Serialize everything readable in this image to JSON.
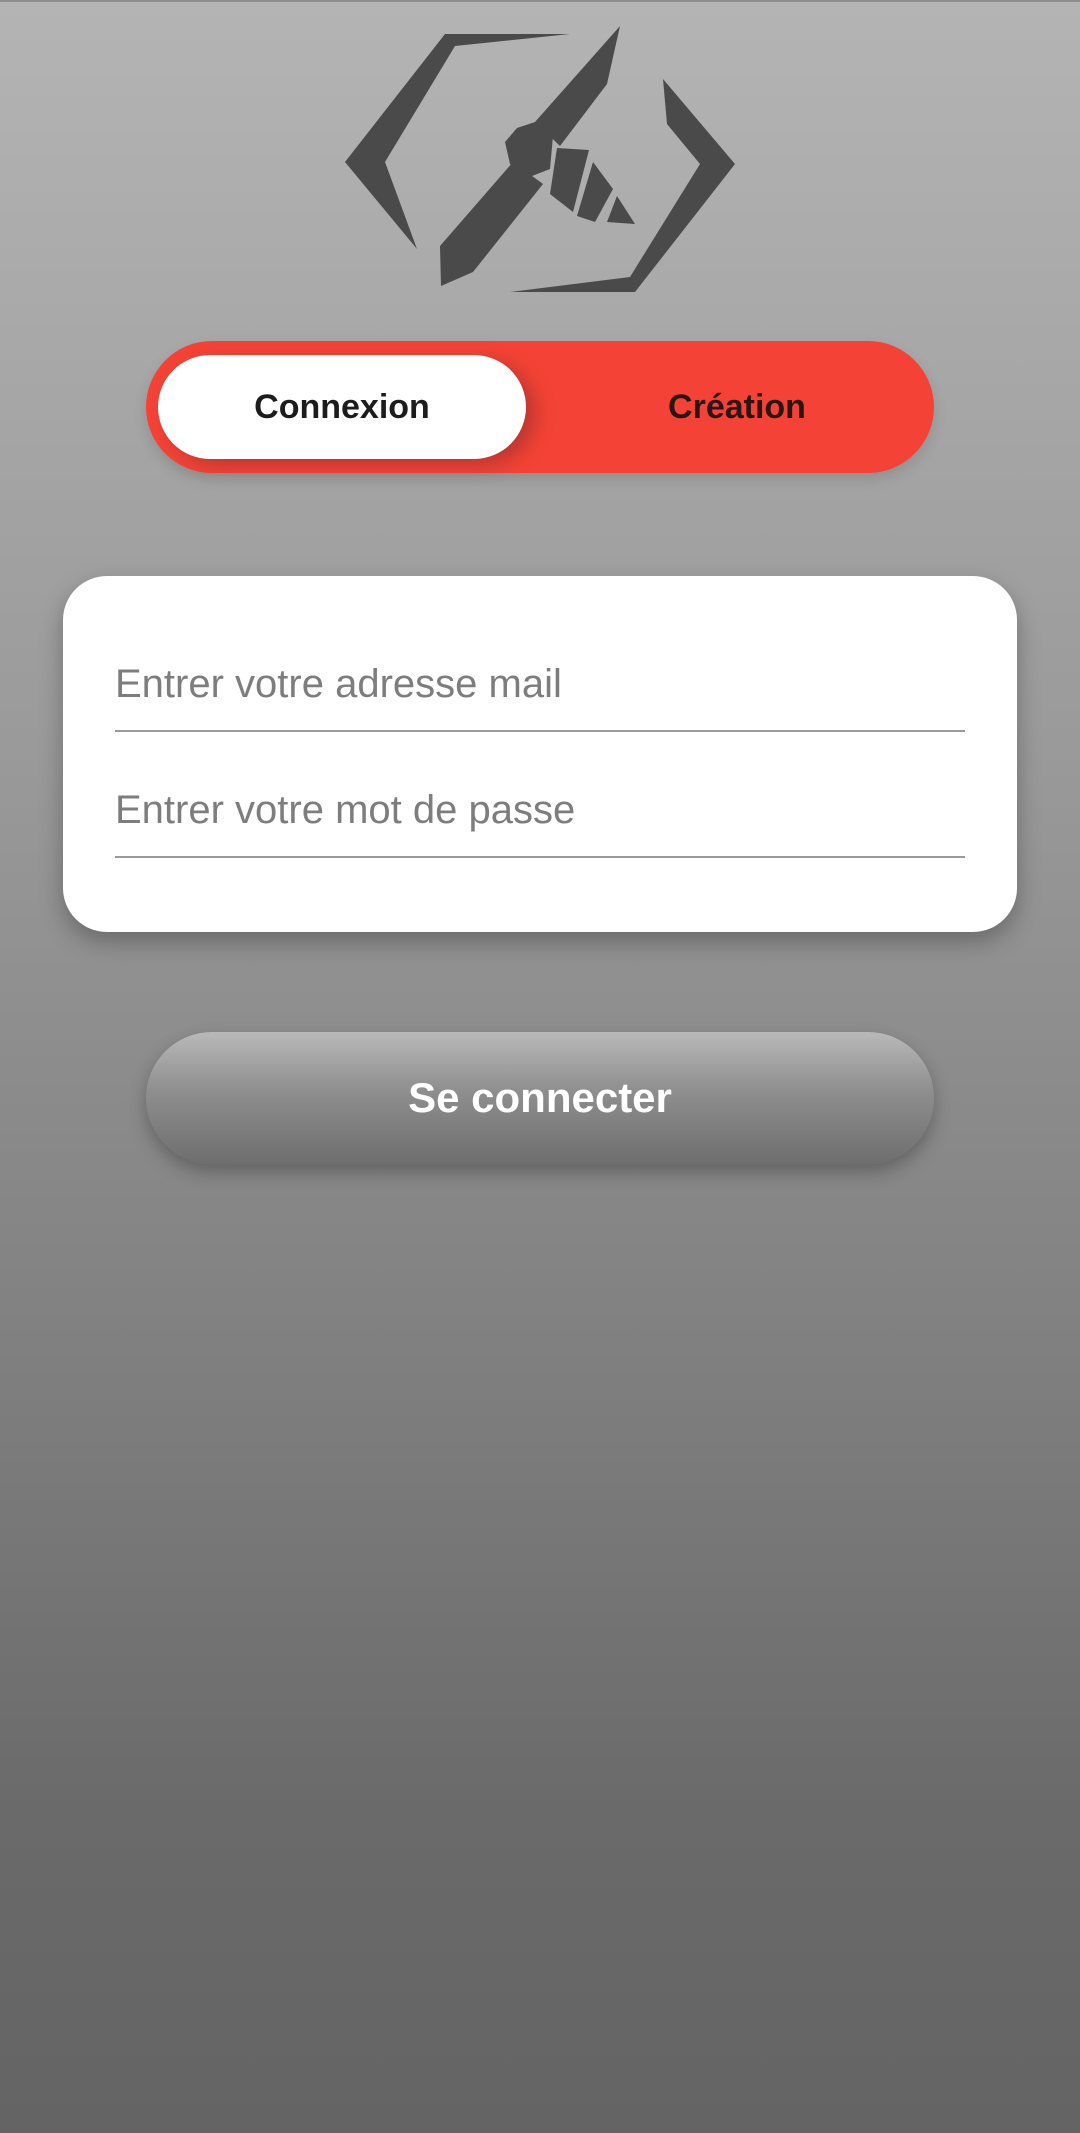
{
  "logo": {
    "icon": "bee-hexagon-logo-icon",
    "color": "#4a4a4a"
  },
  "auth_toggle": {
    "login_label": "Connexion",
    "signup_label": "Création",
    "active": "Connexion",
    "accent_color": "#f44336"
  },
  "form": {
    "email_placeholder": "Entrer votre adresse mail",
    "email_value": "",
    "password_placeholder": "Entrer votre mot de passe",
    "password_value": ""
  },
  "submit": {
    "label": "Se connecter"
  }
}
